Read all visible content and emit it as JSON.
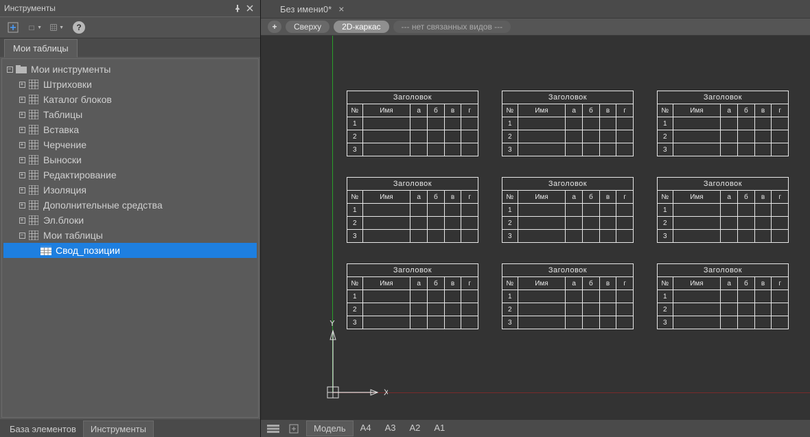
{
  "panel": {
    "title": "Инструменты",
    "top_tab": "Мои таблицы",
    "bottom_tabs": [
      "База элементов",
      "Инструменты"
    ],
    "bottom_active": 1
  },
  "tree": {
    "root": "Мои инструменты",
    "items": [
      "Штриховки",
      "Каталог блоков",
      "Таблицы",
      "Вставка",
      "Черчение",
      "Выноски",
      "Редактирование",
      "Изоляция",
      "Дополнительные средства",
      "Эл.блоки",
      "Мои таблицы"
    ],
    "leaf": "Свод_позиции"
  },
  "doc": {
    "name": "Без имени0*"
  },
  "view": {
    "plus": "+",
    "top": "Сверху",
    "wire": "2D-каркас",
    "none": "--- нет связанных видов ---"
  },
  "cad_table": {
    "title": "Заголовок",
    "cols": [
      "№",
      "Имя",
      "а",
      "б",
      "в",
      "г"
    ],
    "rows": [
      "1",
      "2",
      "3"
    ]
  },
  "status": {
    "tabs": [
      "Модель",
      "A4",
      "A3",
      "A2",
      "A1"
    ],
    "active": 0
  },
  "axis": {
    "x": "X",
    "y": "Y"
  }
}
